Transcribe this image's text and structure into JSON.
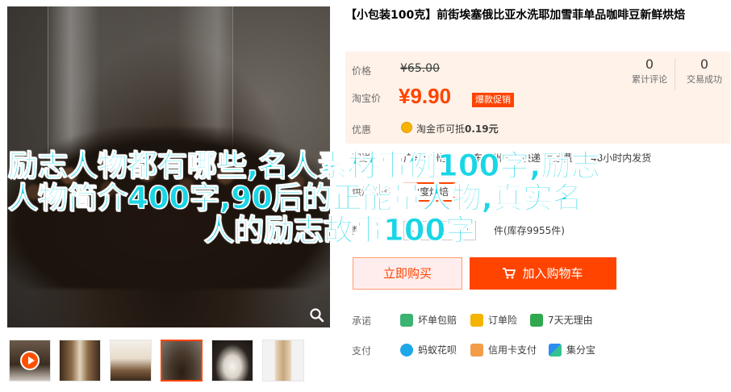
{
  "product": {
    "title": "【小包装100克】前街埃塞俄比亚水洗耶加雪菲单品咖啡豆新鲜烘焙"
  },
  "price": {
    "orig_label": "价格",
    "orig_value": "¥65.00",
    "current_label": "淘宝价",
    "currency": "¥",
    "current_value": "9.90",
    "promo_badge": "爆款促销",
    "promo_label": "优惠",
    "coin_text": "淘金币可抵",
    "coin_amount": "0.19元"
  },
  "stats": {
    "reviews_count": "0",
    "reviews_label": "累计评论",
    "deals_count": "0",
    "deals_label": "交易成功"
  },
  "shipping": {
    "label": "配送",
    "origin": "广东广州至",
    "destination": "广东广州",
    "fee": "快递 免运费",
    "dispatch": "48小时内发货"
  },
  "option": {
    "label": "烘焙程度",
    "selected": "中度烘焙"
  },
  "quantity": {
    "label": "数量",
    "minus": "-",
    "value": "1",
    "plus": "+",
    "stock": "件(库存9955件)"
  },
  "actions": {
    "buy_now": "立即购买",
    "add_to_cart": "加入购物车"
  },
  "promise": {
    "label": "承诺",
    "items": [
      "坏单包赔",
      "订单险",
      "7天无理由"
    ]
  },
  "payment": {
    "label": "支付",
    "items": [
      "蚂蚁花呗",
      "信用卡支付",
      "集分宝"
    ]
  },
  "overlay_text": {
    "line1": "励志人物都有哪些,名人素材事例100字,励志",
    "line2": "人物简介400字,90后的正能量人物,真实名",
    "line3": "人的励志故事100字"
  },
  "colors": {
    "accent": "#ff4400",
    "price_bg": "#fff2e8",
    "overlay": "#19d6e6"
  },
  "icons": {
    "zoom": "magnifier-icon",
    "video": "play-icon",
    "cart": "cart-icon",
    "coin": "coin-icon"
  }
}
